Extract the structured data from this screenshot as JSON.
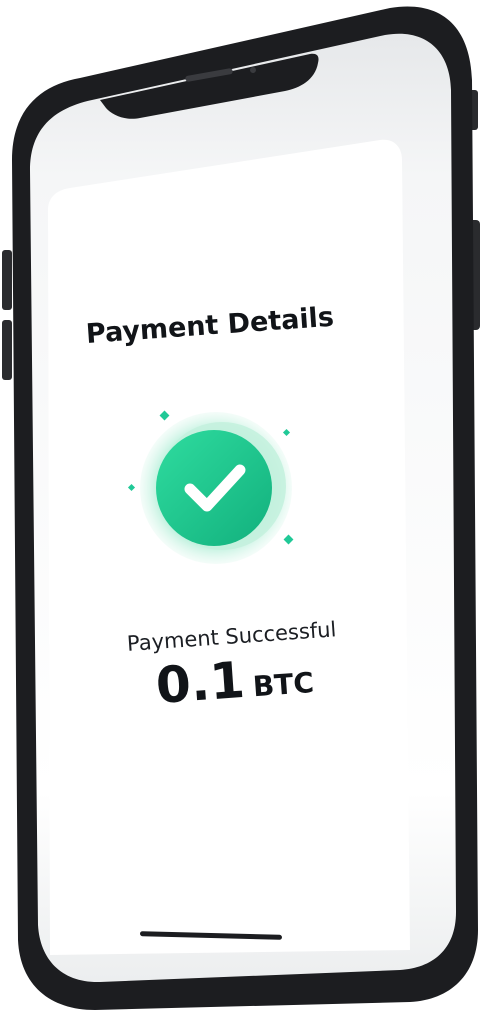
{
  "screen": {
    "title": "Payment Details",
    "status_text": "Payment Successful",
    "amount_value": "0.1",
    "amount_unit": "BTC"
  },
  "icons": {
    "status": "check-icon"
  },
  "colors": {
    "accent": "#20c997",
    "accent_dark": "#12b07d",
    "frame": "#1c1d20"
  }
}
